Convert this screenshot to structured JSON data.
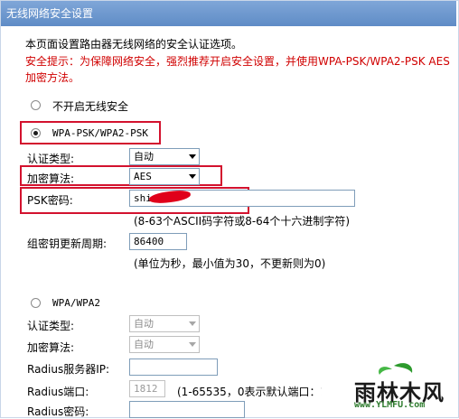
{
  "window": {
    "title": "无线网络安全设置"
  },
  "intro": {
    "description": "本页面设置路由器无线网络的安全认证选项。",
    "tip_line1": "安全提示：为保障网络安全，强烈推荐开启安全设置，并使用WPA-PSK/WPA2-PSK AES",
    "tip_line2": "加密方法。"
  },
  "options": {
    "disable_label": "不开启无线安全",
    "wpa_psk_label": "WPA-PSK/WPA2-PSK",
    "wpa_psk_selected": true
  },
  "wpa_psk": {
    "auth_type_label": "认证类型:",
    "auth_type_value": "自动",
    "encryption_label": "加密算法:",
    "encryption_value": "AES",
    "psk_label": "PSK密码:",
    "psk_value": "shi",
    "psk_hint": "(8-63个ASCII码字符或8-64个十六进制字符)",
    "rekey_label": "组密钥更新周期:",
    "rekey_value": "86400",
    "rekey_hint": "(单位为秒，最小值为30，不更新则为0)"
  },
  "wpa_enterprise": {
    "label": "WPA/WPA2",
    "auth_type_label": "认证类型:",
    "auth_type_value": "自动",
    "encryption_label": "加密算法:",
    "encryption_value": "自动",
    "radius_ip_label": "Radius服务器IP:",
    "radius_ip_value": "",
    "radius_port_label": "Radius端口:",
    "radius_port_value": "1812",
    "radius_port_hint": "(1-65535，0表示默认端口：18",
    "radius_password_label": "Radius密码:",
    "radius_password_value": ""
  },
  "watermark": {
    "brand": "雨林木风",
    "url": "www.YLMFU.com"
  },
  "colors": {
    "titlebar": "#6b96cf",
    "highlight": "#d3122e",
    "warning": "#d00000"
  }
}
